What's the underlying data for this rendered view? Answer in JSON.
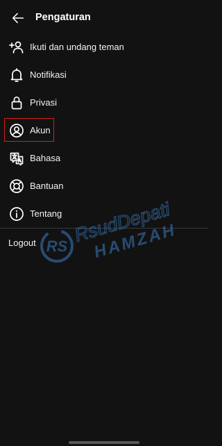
{
  "header": {
    "back_icon": "arrow-left-icon",
    "title": "Pengaturan"
  },
  "menu": [
    {
      "label": "Ikuti dan undang teman",
      "icon": "add-person-icon"
    },
    {
      "label": "Notifikasi",
      "icon": "bell-icon"
    },
    {
      "label": "Privasi",
      "icon": "lock-icon"
    },
    {
      "label": "Akun",
      "icon": "account-circle-icon",
      "highlighted": true
    },
    {
      "label": "Bahasa",
      "icon": "translate-icon"
    },
    {
      "label": "Bantuan",
      "icon": "lifebuoy-icon"
    },
    {
      "label": "Tentang",
      "icon": "info-icon"
    }
  ],
  "logout_label": "Logout",
  "watermark": {
    "line1": "RsudDepati",
    "line2": "HAMZAH",
    "badge": "RS"
  },
  "colors": {
    "background": "#121212",
    "text": "#ffffff",
    "highlight": "#d81e1e",
    "watermark": "#3b7bbf"
  }
}
